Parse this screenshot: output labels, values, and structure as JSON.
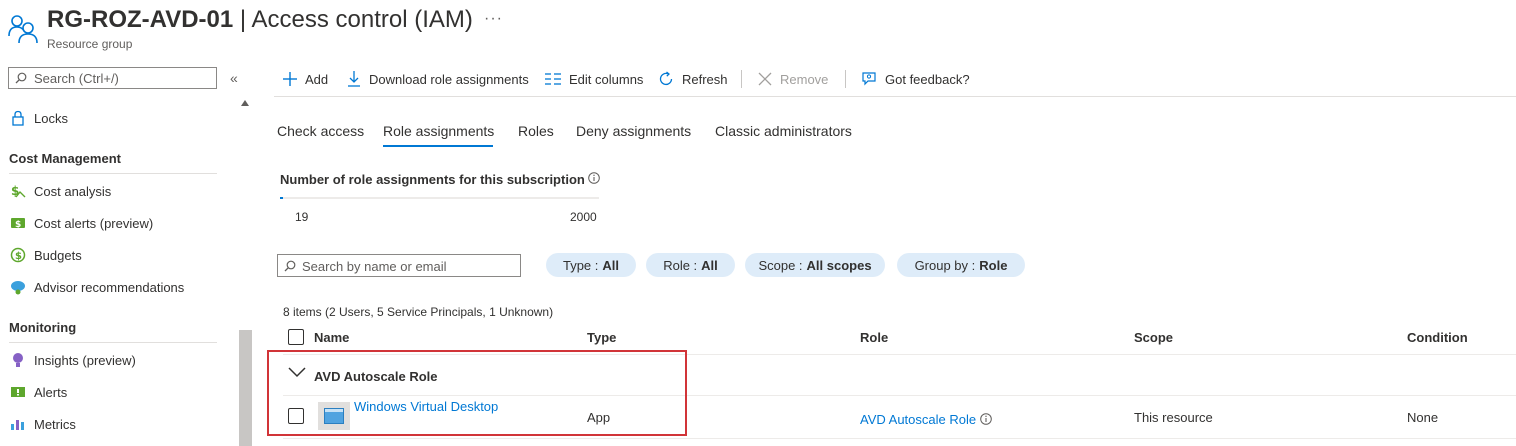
{
  "header": {
    "title_bold": "RG-ROZ-AVD-01",
    "title_rest": " | Access control (IAM)",
    "more": "···",
    "subtitle": "Resource group"
  },
  "sidebar": {
    "search_placeholder": "Search (Ctrl+/)",
    "collapse": "«",
    "items": [
      {
        "label": "Locks",
        "icon": "lock-icon"
      },
      {
        "section": "Cost Management"
      },
      {
        "label": "Cost analysis",
        "icon": "cost-analysis-icon"
      },
      {
        "label": "Cost alerts (preview)",
        "icon": "cost-alerts-icon"
      },
      {
        "label": "Budgets",
        "icon": "budgets-icon"
      },
      {
        "label": "Advisor recommendations",
        "icon": "advisor-icon"
      },
      {
        "section": "Monitoring"
      },
      {
        "label": "Insights (preview)",
        "icon": "insights-icon"
      },
      {
        "label": "Alerts",
        "icon": "alerts-icon"
      },
      {
        "label": "Metrics",
        "icon": "metrics-icon"
      }
    ]
  },
  "toolbar": {
    "add": "Add",
    "download": "Download role assignments",
    "edit_columns": "Edit columns",
    "refresh": "Refresh",
    "remove": "Remove",
    "feedback": "Got feedback?"
  },
  "tabs": [
    "Check access",
    "Role assignments",
    "Roles",
    "Deny assignments",
    "Classic administrators"
  ],
  "active_tab": "Role assignments",
  "assignment_count": {
    "title": "Number of role assignments for this subscription",
    "current": "19",
    "max": "2000",
    "fraction": 0.0095
  },
  "filters": {
    "search_placeholder": "Search by name or email",
    "pills": [
      {
        "label": "Type : ",
        "value": "All"
      },
      {
        "label": "Role : ",
        "value": "All"
      },
      {
        "label": "Scope : ",
        "value": "All scopes"
      },
      {
        "label": "Group by : ",
        "value": "Role"
      }
    ]
  },
  "table": {
    "items_summary": "8 items (2 Users, 5 Service Principals, 1 Unknown)",
    "columns": [
      "Name",
      "Type",
      "Role",
      "Scope",
      "Condition"
    ],
    "groups": [
      {
        "label": "AVD Autoscale Role",
        "rows": [
          {
            "name": "Windows Virtual Desktop",
            "type": "App",
            "role": "AVD Autoscale Role",
            "scope": "This resource",
            "condition": "None"
          }
        ]
      }
    ]
  },
  "colors": {
    "accent": "#0078d4",
    "highlight": "#d13438",
    "pill_bg": "#deecf9"
  }
}
